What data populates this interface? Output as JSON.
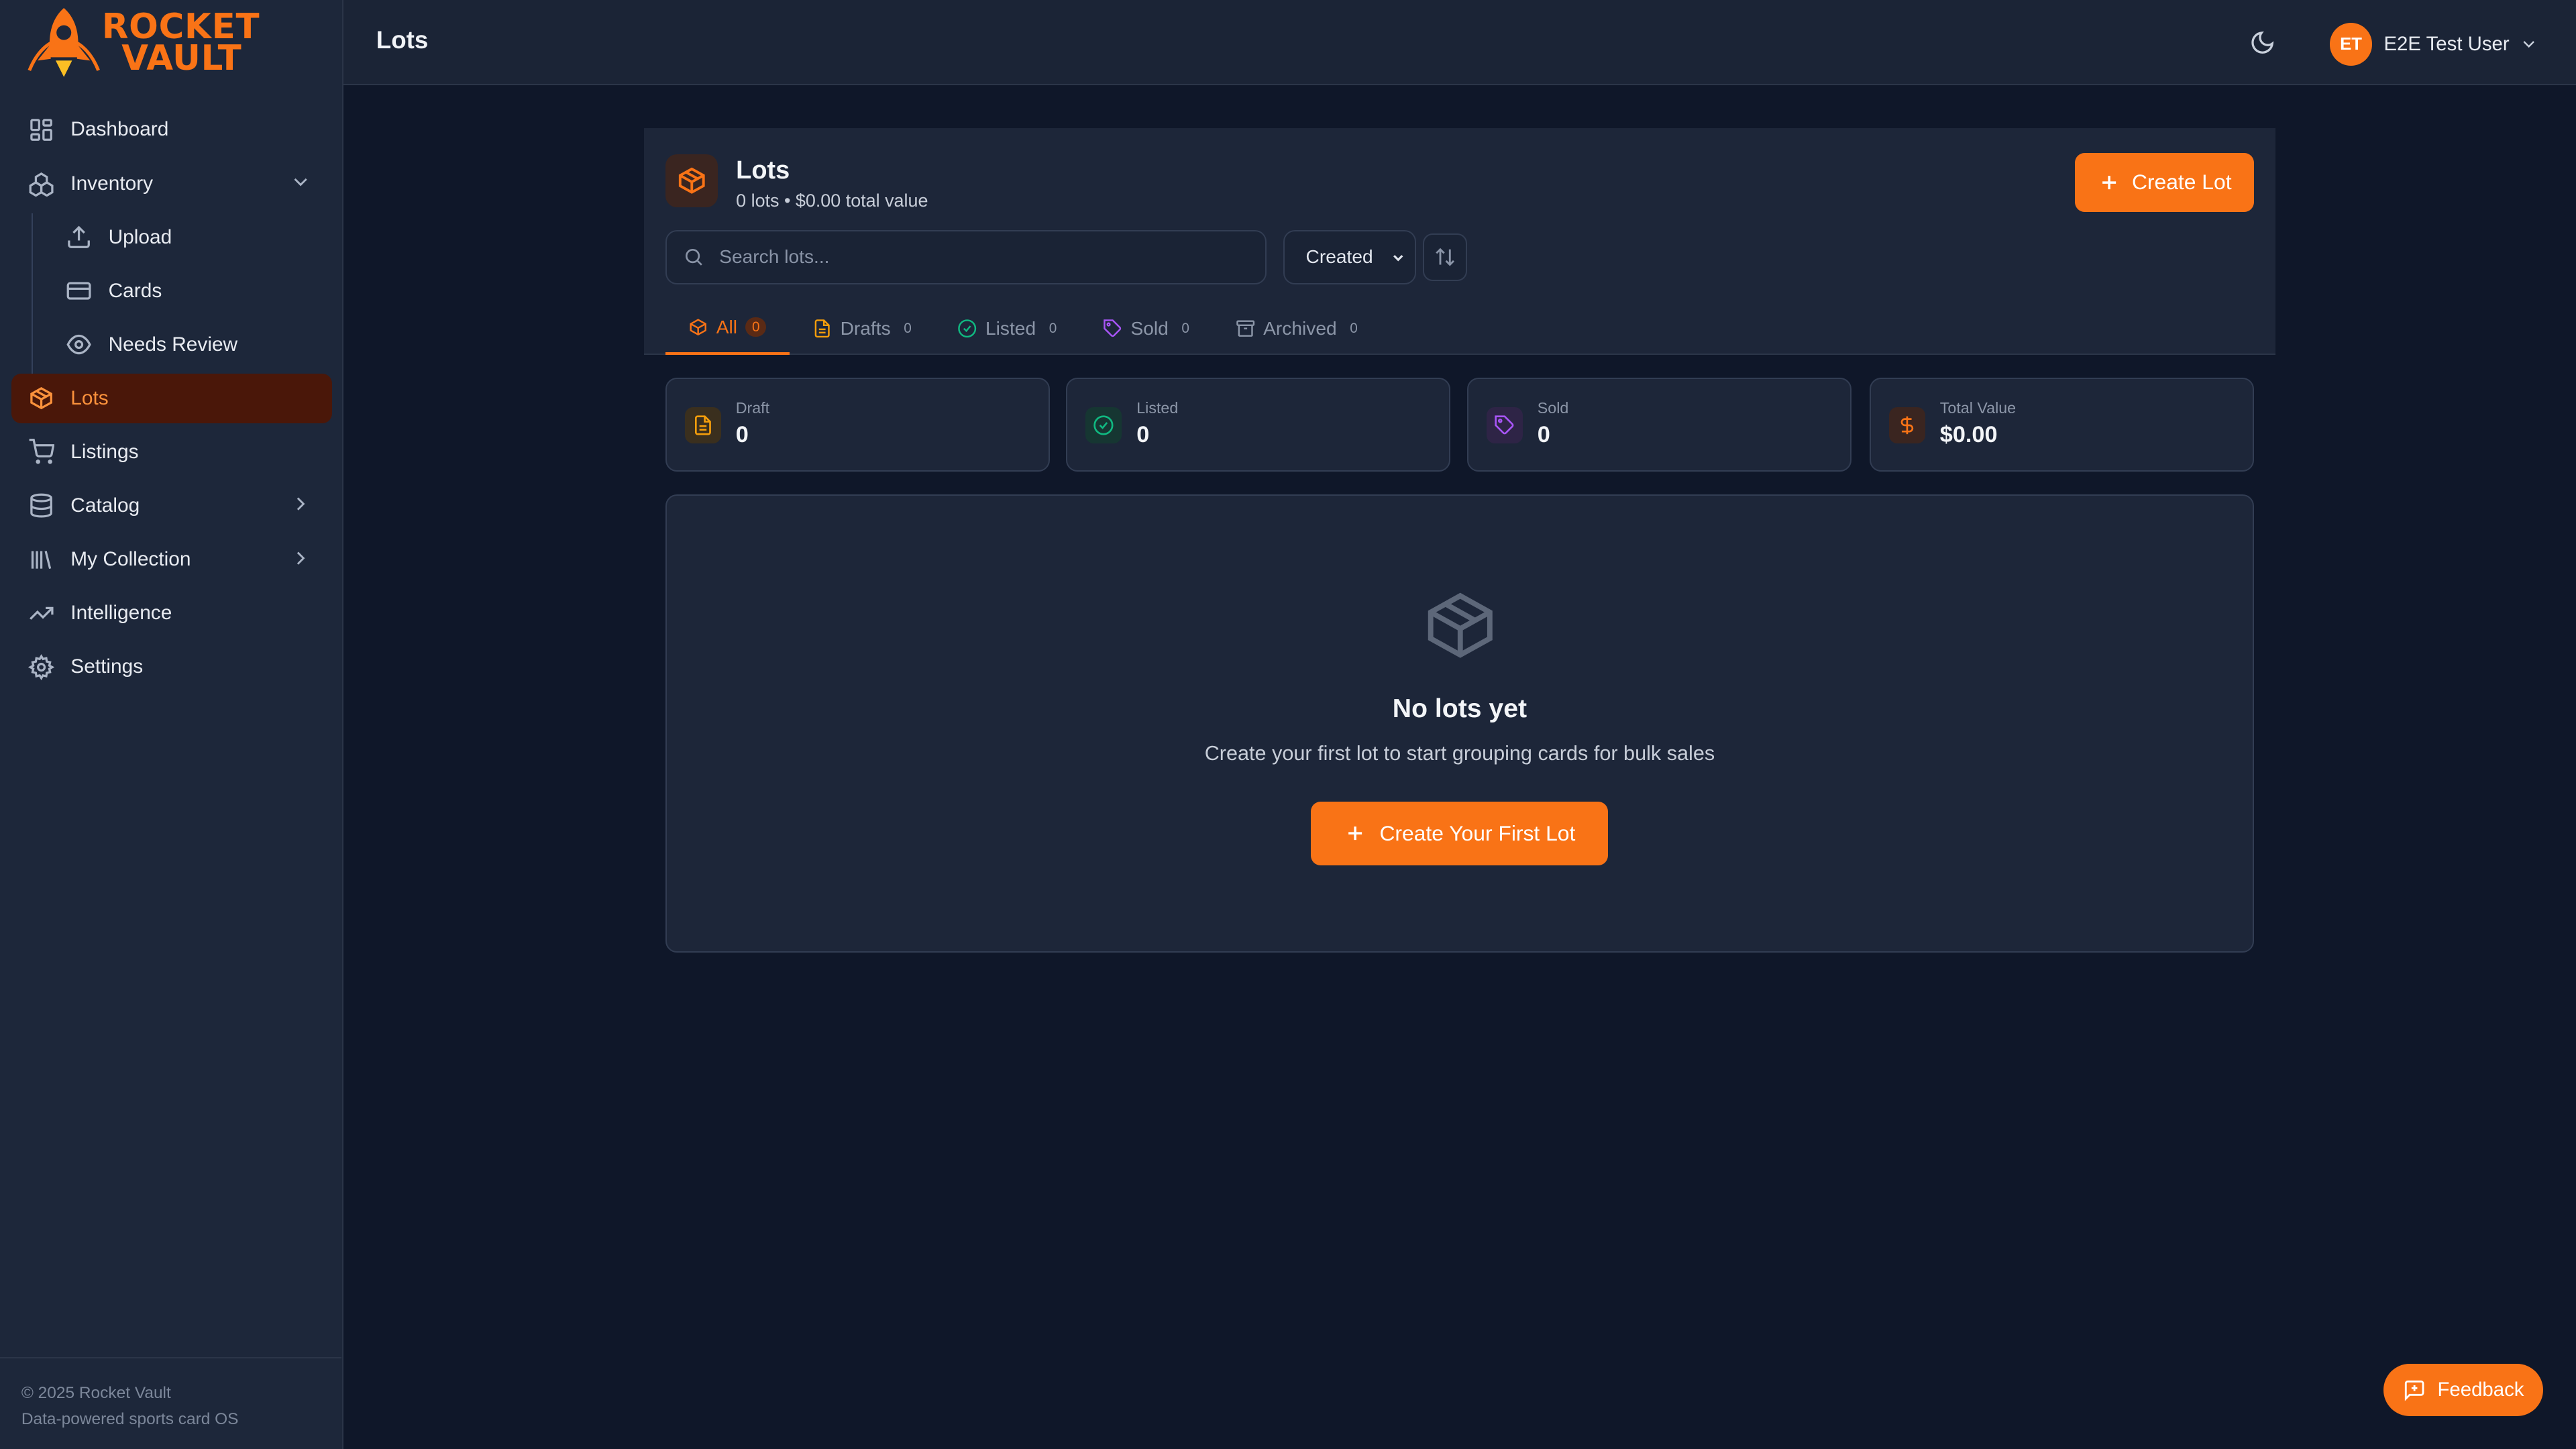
{
  "brand": {
    "line1": "ROCKET",
    "line2": "VAULT",
    "accent": "#f97316"
  },
  "sidebar": {
    "items": [
      {
        "label": "Dashboard",
        "icon": "dashboard-icon"
      },
      {
        "label": "Inventory",
        "icon": "inventory-icon",
        "expanded": true
      },
      {
        "label": "Upload",
        "icon": "upload-icon"
      },
      {
        "label": "Cards",
        "icon": "cards-icon"
      },
      {
        "label": "Needs Review",
        "icon": "eye-icon"
      },
      {
        "label": "Lots",
        "icon": "package-icon",
        "active": true
      },
      {
        "label": "Listings",
        "icon": "cart-icon"
      },
      {
        "label": "Catalog",
        "icon": "database-icon"
      },
      {
        "label": "My Collection",
        "icon": "library-icon"
      },
      {
        "label": "Intelligence",
        "icon": "trending-icon"
      },
      {
        "label": "Settings",
        "icon": "gear-icon"
      }
    ],
    "footer": {
      "copyright": "© 2025 Rocket Vault",
      "tagline": "Data-powered sports card OS"
    }
  },
  "header": {
    "title": "Lots",
    "user": {
      "initials": "ET",
      "name": "E2E Test User"
    }
  },
  "lots": {
    "title": "Lots",
    "summary": "0 lots • $0.00 total value",
    "create_label": "Create Lot",
    "search_placeholder": "Search lots...",
    "sort_value": "Created",
    "tabs": [
      {
        "label": "All",
        "count": "0",
        "icon": "package-icon"
      },
      {
        "label": "Drafts",
        "count": "0",
        "icon": "file-icon"
      },
      {
        "label": "Listed",
        "count": "0",
        "icon": "check-circle-icon"
      },
      {
        "label": "Sold",
        "count": "0",
        "icon": "tag-icon"
      },
      {
        "label": "Archived",
        "count": "0",
        "icon": "archive-icon"
      }
    ],
    "stats": [
      {
        "label": "Draft",
        "value": "0",
        "icon": "file-icon",
        "color": "#f59e0b"
      },
      {
        "label": "Listed",
        "value": "0",
        "icon": "check-circle-icon",
        "color": "#10b981"
      },
      {
        "label": "Sold",
        "value": "0",
        "icon": "tag-icon",
        "color": "#a855f7"
      },
      {
        "label": "Total Value",
        "value": "$0.00",
        "icon": "dollar-icon",
        "color": "#f97316"
      }
    ],
    "empty": {
      "title": "No lots yet",
      "description": "Create your first lot to start grouping cards for bulk sales",
      "button_label": "Create Your First Lot"
    }
  },
  "feedback_label": "Feedback"
}
